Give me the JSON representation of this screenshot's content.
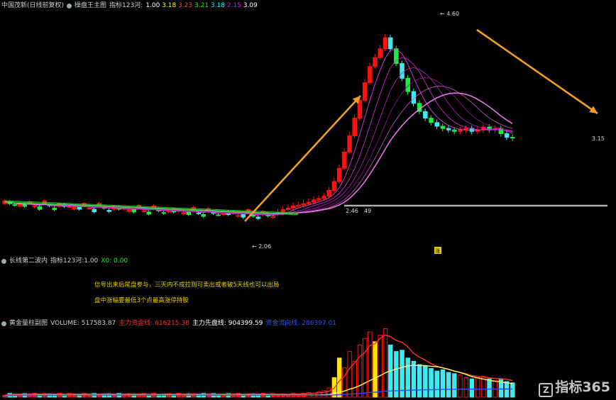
{
  "main_panel": {
    "stock_name": "中国茂新(日线前复权)",
    "indicator_name": "操盘王主图",
    "indicator_params": "指标123河:",
    "indicator_values": [
      "1.00",
      "3.18",
      "3.23",
      "3.21",
      "3.18",
      "2.15",
      "3.09"
    ],
    "value_colors": [
      "#ffffff",
      "#ffff00",
      "#ff4040",
      "#00ff00",
      "#00ffff",
      "#ff00ff",
      "#ffffff"
    ],
    "high_label": "4.60",
    "low_label": "2.06",
    "level_label_left": "2.46",
    "level_label_right": "49",
    "right_label": "3.15",
    "marker_label": "涨"
  },
  "middle_panel": {
    "title": "长线第二波内",
    "params": "指标123河:1.00",
    "value": "X0: 0.00",
    "note_line1": "信号出来后尾盘参与，三天内不成拉则可卖出或者破5天线也可以出局",
    "note_line2": "盘中涨幅要最低3个点最高涨停持股"
  },
  "volume_panel": {
    "title": "黄金量柱副图",
    "volume_label": "VOLUME: 517583.87",
    "series1_label": "主力资金线: 616215.38",
    "series2_label": "主力先盘线: 904399.59",
    "series3_label": "资金流向线: 286397.01",
    "series1_color": "#ff3030",
    "series2_color": "#ffffff",
    "series3_color": "#3050ff"
  },
  "watermark": {
    "text": "指标365",
    "icon": "logo-icon"
  },
  "colors": {
    "up": "#ff1010",
    "down_cyan": "#40e8f0",
    "down_green": "#18f040",
    "arrow": "#f0a020",
    "level_line": "#b0b0b0"
  }
}
